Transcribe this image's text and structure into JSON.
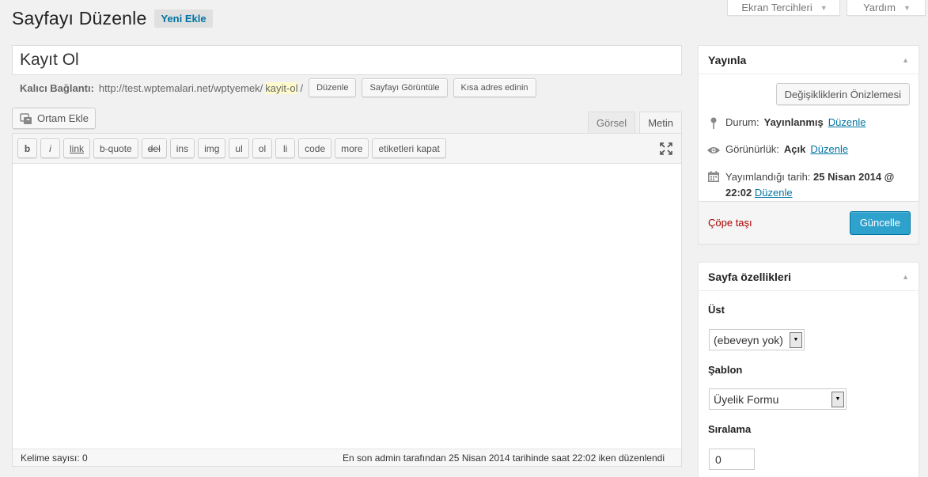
{
  "screen_tabs": {
    "options_label": "Ekran Tercihleri",
    "help_label": "Yardım"
  },
  "header": {
    "title": "Sayfayı Düzenle",
    "add_new_label": "Yeni Ekle"
  },
  "post": {
    "title": "Kayıt Ol"
  },
  "permalink": {
    "label": "Kalıcı Bağlantı:",
    "base_url": "http://test.wptemalari.net/wptyemek/",
    "slug": "kayit-ol",
    "trailing": "/",
    "edit_label": "Düzenle",
    "view_label": "Sayfayı Görüntüle",
    "shortlink_label": "Kısa adres edinin"
  },
  "media": {
    "add_media_label": "Ortam Ekle"
  },
  "editor_tabs": {
    "visual": "Görsel",
    "text": "Metin"
  },
  "quicktags": [
    "b",
    "i",
    "link",
    "b-quote",
    "del",
    "ins",
    "img",
    "ul",
    "ol",
    "li",
    "code",
    "more",
    "etiketleri kapat"
  ],
  "status_bar": {
    "word_count": "Kelime sayısı: 0",
    "last_edit": "En son admin tarafından 25 Nisan 2014 tarihinde saat 22:02 iken düzenlendi"
  },
  "publish_box": {
    "title": "Yayınla",
    "preview_label": "Değişikliklerin Önizlemesi",
    "status_label": "Durum:",
    "status_value": "Yayınlanmış",
    "status_edit": "Düzenle",
    "visibility_label": "Görünürlük:",
    "visibility_value": "Açık",
    "visibility_edit": "Düzenle",
    "date_label": "Yayımlandığı tarih:",
    "date_value": "25 Nisan 2014 @ 22:02",
    "date_edit": "Düzenle",
    "trash_label": "Çöpe taşı",
    "update_label": "Güncelle"
  },
  "page_attributes": {
    "title": "Sayfa özellikleri",
    "parent_label": "Üst",
    "parent_value": "(ebeveyn yok)",
    "template_label": "Şablon",
    "template_value": "Üyelik Formu",
    "order_label": "Sıralama",
    "order_value": "0"
  },
  "colors": {
    "primary_button": "#2ea2cc",
    "link": "#0074a2",
    "trash": "#aa0000",
    "background": "#f1f1f1"
  }
}
